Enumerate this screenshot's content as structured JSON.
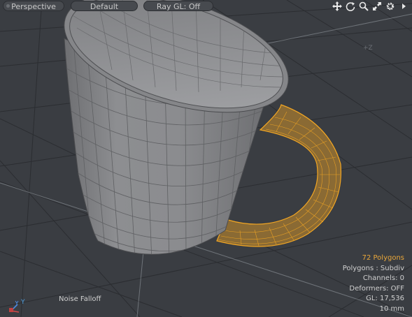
{
  "viewport_bar": {
    "view_label": "Perspective",
    "style_label": "Default",
    "raygl_label": "Ray GL: Off"
  },
  "toolbar_icons": [
    "move-icon",
    "rotate-icon",
    "zoom-icon",
    "fit-icon",
    "gear-icon",
    "more-arrow-icon"
  ],
  "axis": {
    "z_label": "+Z"
  },
  "gizmo": {
    "y_label": "Y"
  },
  "falloff_label": "Noise Falloff",
  "stats": {
    "polygons": "72 Polygons",
    "polygon_type": "Polygons : Subdiv",
    "channels": "Channels: 0",
    "deformers": "Deformers: OFF",
    "gl": "GL: 17,536",
    "scale": "10 mm"
  },
  "colors": {
    "background": "#3a3d42",
    "grid": "#2a2c30",
    "mesh": "#8c8c8c",
    "selection": "#f2a623",
    "text": "#d0d0d0"
  }
}
